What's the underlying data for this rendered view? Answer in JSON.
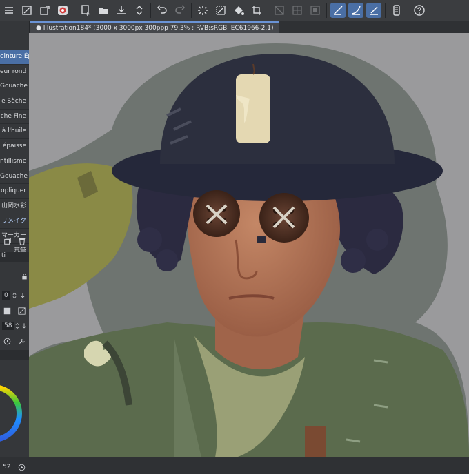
{
  "document_tab": {
    "title": "Illustration184* (3000 x 3000px 300ppp 79.3% : RVB:sRGB IEC61966-2.1)"
  },
  "brush_list": {
    "items": [
      "einture Ép",
      "eur rond",
      "Gouache",
      "e Sèche",
      "che Fine",
      "à l'huile",
      "épaisse",
      "ntillisme",
      "Gouache",
      "opliquer",
      "山岡水彩",
      "リメイク",
      "マーカー",
      "荒筆"
    ]
  },
  "left_panel": {
    "value_1": "0",
    "value_2": "58",
    "value_3": "52",
    "label_ti": "ti"
  },
  "colors": {
    "accent": "#4a6fa5",
    "toolbar_bg": "#3b3d40",
    "canvas_bg": "#9a9a9c"
  }
}
